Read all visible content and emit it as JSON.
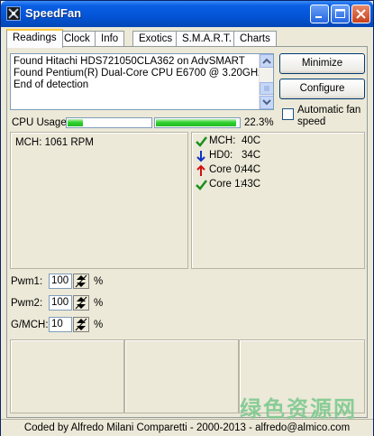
{
  "window": {
    "title": "SpeedFan"
  },
  "tabs": [
    "Readings",
    "Clock",
    "Info",
    "Exotics",
    "S.M.A.R.T.",
    "Charts"
  ],
  "log": [
    "Found Hitachi HDS721050CLA362 on AdvSMART",
    "Found Pentium(R) Dual-Core CPU E6700 @ 3.20GHz",
    "End of detection"
  ],
  "buttons": {
    "minimize": "Minimize",
    "configure": "Configure"
  },
  "automatic_fan_speed": {
    "label": "Automatic fan speed",
    "checked": false
  },
  "cpu": {
    "label": "CPU Usage",
    "core_usage": [
      0.18,
      0.97
    ],
    "total": "22.3%"
  },
  "fans": [
    "MCH: 1061 RPM"
  ],
  "temps": [
    {
      "name": "MCH:",
      "value": "40C",
      "icon": "check-icon",
      "color": "#1a8f1a"
    },
    {
      "name": "HD0:",
      "value": "34C",
      "icon": "arrow-down-icon",
      "color": "#1030c8"
    },
    {
      "name": "Core 0:",
      "value": "44C",
      "icon": "arrow-up-icon",
      "color": "#d01010"
    },
    {
      "name": "Core 1:",
      "value": "43C",
      "icon": "check-icon",
      "color": "#1a8f1a"
    }
  ],
  "pwm": [
    {
      "label": "Pwm1:",
      "value": "100",
      "unit": "%"
    },
    {
      "label": "Pwm2:",
      "value": "100",
      "unit": "%"
    },
    {
      "label": "G/MCH:",
      "value": "10",
      "unit": "%"
    }
  ],
  "status": "Coded by Alfredo Milani Comparetti - 2000-2013 - alfredo@almico.com",
  "watermark": {
    "text": "绿色资源网",
    "sub": "www.downcc.com"
  }
}
